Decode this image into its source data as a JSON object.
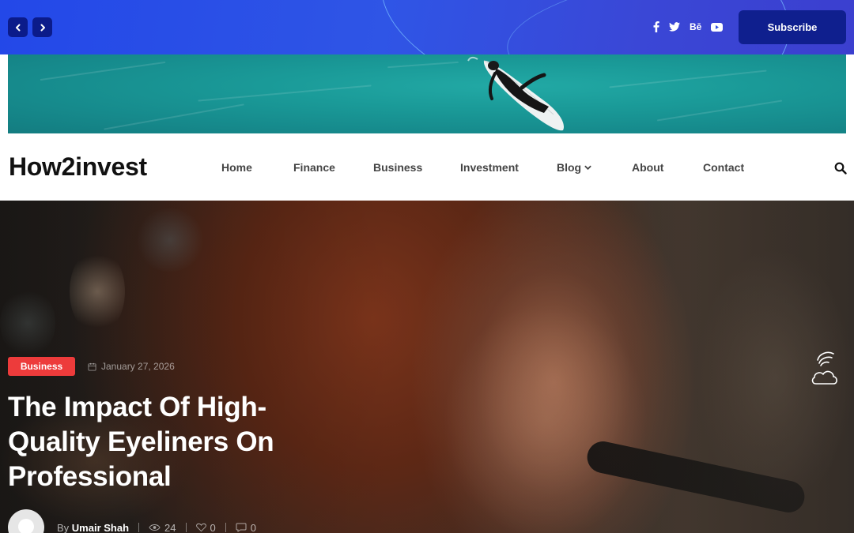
{
  "topbar": {
    "prev_icon": "chevron-left-icon",
    "next_icon": "chevron-right-icon",
    "socials": [
      {
        "name": "facebook-icon",
        "glyph": "f"
      },
      {
        "name": "twitter-icon",
        "glyph": ""
      },
      {
        "name": "behance-icon",
        "glyph": "Bē"
      },
      {
        "name": "youtube-icon",
        "glyph": ""
      }
    ],
    "subscribe_label": "Subscribe"
  },
  "header": {
    "logo": "How2invest",
    "menu": [
      {
        "label": "Home"
      },
      {
        "label": "Finance"
      },
      {
        "label": "Business"
      },
      {
        "label": "Investment"
      },
      {
        "label": "Blog",
        "has_dropdown": true
      },
      {
        "label": "About"
      },
      {
        "label": "Contact"
      }
    ],
    "search_icon": "search-icon"
  },
  "hero": {
    "category": "Business",
    "date": "January 27, 2026",
    "title": "The Impact Of High-Quality Eyeliners On Professional",
    "author_prefix": "By",
    "author": "Umair Shah",
    "views": "24",
    "likes": "0",
    "comments": "0",
    "weather_icon": "cloud-weather-icon"
  },
  "colors": {
    "topbar": "#2348e8",
    "button_dark": "#0f1f8e",
    "badge": "#ed3b3b",
    "sea": "#1a9a98"
  }
}
